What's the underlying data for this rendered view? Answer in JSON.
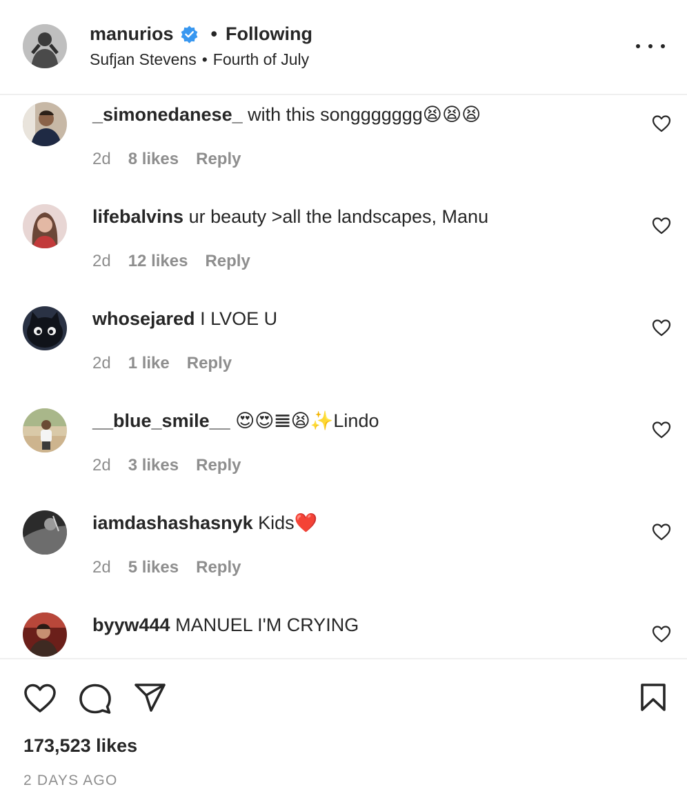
{
  "post": {
    "username": "manurios",
    "follow_status": "Following",
    "music_artist": "Sufjan Stevens",
    "music_title": "Fourth of July",
    "verified": true
  },
  "comments": [
    {
      "username": "_simonedanese_",
      "text": "with this songgggggg😫😫😫",
      "age": "2d",
      "likes": "8 likes",
      "reply": "Reply"
    },
    {
      "username": "lifebalvins",
      "text": "ur beauty >all the landscapes, Manu",
      "age": "2d",
      "likes": "12 likes",
      "reply": "Reply"
    },
    {
      "username": "whosejared",
      "text": "I LVOE U",
      "age": "2d",
      "likes": "1 like",
      "reply": "Reply"
    },
    {
      "username": "__blue_smile__",
      "text": "😍😍𝌆😫✨Lindo",
      "age": "2d",
      "likes": "3 likes",
      "reply": "Reply"
    },
    {
      "username": "iamdashashasnyk",
      "text": "Kids❤️",
      "age": "2d",
      "likes": "5 likes",
      "reply": "Reply"
    },
    {
      "username": "byyw444",
      "text": "MANUEL I'M CRYING",
      "age": "",
      "likes": "",
      "reply": ""
    }
  ],
  "footer": {
    "likes": "173,523 likes",
    "time_ago": "2 DAYS AGO"
  },
  "icons": {
    "more": "more-options-icon",
    "like": "heart-icon",
    "comment": "comment-icon",
    "share": "paper-plane-icon",
    "save": "bookmark-icon",
    "verified": "verified-badge-icon"
  },
  "colors": {
    "text": "#262626",
    "secondary": "#8e8e8e",
    "verified": "#3897f0",
    "divider": "#efefef"
  }
}
